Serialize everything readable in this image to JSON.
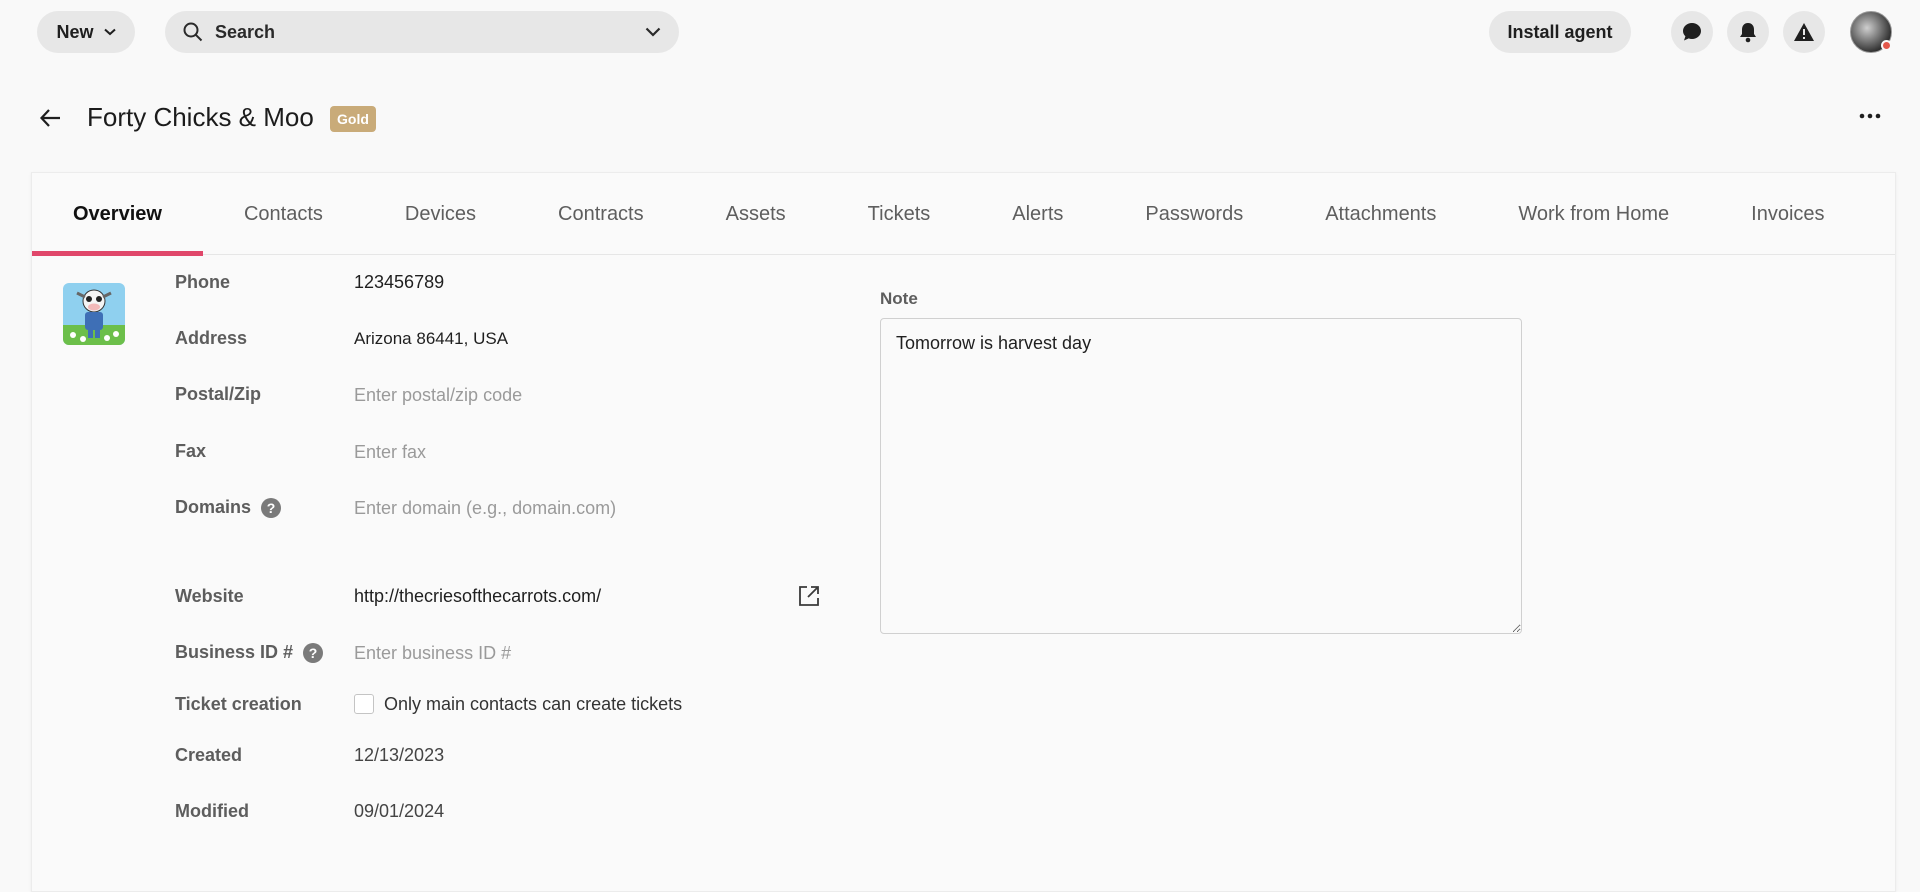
{
  "topbar": {
    "new_label": "New",
    "search_placeholder": "Search",
    "install_label": "Install agent",
    "icons": [
      "chat-icon",
      "bell-icon",
      "alert-icon"
    ]
  },
  "header": {
    "company_name": "Forty Chicks & Moo",
    "tier": "Gold"
  },
  "tabs": [
    {
      "label": "Overview",
      "active": true
    },
    {
      "label": "Contacts"
    },
    {
      "label": "Devices"
    },
    {
      "label": "Contracts"
    },
    {
      "label": "Assets"
    },
    {
      "label": "Tickets"
    },
    {
      "label": "Alerts"
    },
    {
      "label": "Passwords"
    },
    {
      "label": "Attachments"
    },
    {
      "label": "Work from Home"
    },
    {
      "label": "Invoices"
    }
  ],
  "fields": {
    "phone": {
      "label": "Phone",
      "value": "123456789"
    },
    "address": {
      "label": "Address",
      "value": "Arizona 86441, USA"
    },
    "postal": {
      "label": "Postal/Zip",
      "placeholder": "Enter postal/zip code"
    },
    "fax": {
      "label": "Fax",
      "placeholder": "Enter fax"
    },
    "domains": {
      "label": "Domains",
      "placeholder": "Enter domain (e.g., domain.com)"
    },
    "website": {
      "label": "Website",
      "value": "http://thecriesofthecarrots.com/"
    },
    "business_id": {
      "label": "Business ID #",
      "placeholder": "Enter business ID #"
    },
    "ticket_creation": {
      "label": "Ticket creation",
      "checkbox_label": "Only main contacts can create tickets",
      "checked": false
    },
    "created": {
      "label": "Created",
      "value": "12/13/2023"
    },
    "modified": {
      "label": "Modified",
      "value": "09/01/2024"
    }
  },
  "note": {
    "label": "Note",
    "value": "Tomorrow is harvest day"
  },
  "colors": {
    "accent": "#e0476a",
    "gold_badge": "#c9ab79",
    "avatar_status": "#e3574b"
  }
}
